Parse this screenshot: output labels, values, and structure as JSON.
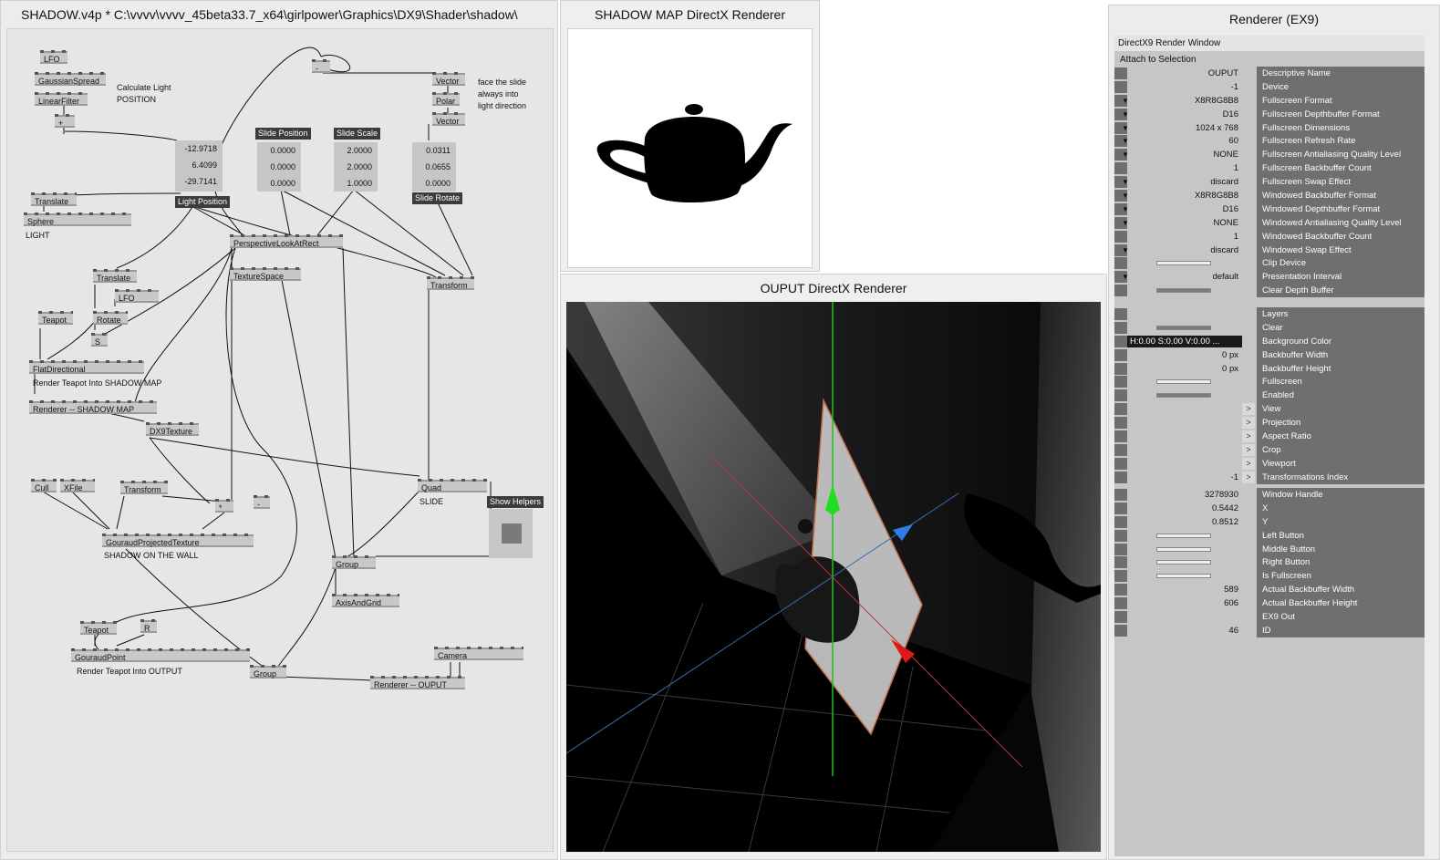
{
  "patch": {
    "title": "SHADOW.v4p *  C:\\vvvv\\vvvv_45beta33.7_x64\\girlpower\\Graphics\\DX9\\Shader\\shadow\\",
    "nodes": {
      "lfo1": "LFO",
      "gaussian": "GaussianSpread",
      "linearfilter": "LinearFilter",
      "plus": "+",
      "minus_top": "-",
      "vector1": "Vector",
      "polar": "Polar",
      "vector2": "Vector",
      "translate1": "Translate",
      "sphere": "Sphere",
      "perspective": "PerspectiveLookAtRect",
      "texturespace": "TextureSpace",
      "transform1": "Transform",
      "translate2": "Translate",
      "lfo2": "LFO",
      "teapot1": "Teapot",
      "rotate": "Rotate",
      "s": "S",
      "flatdirectional": "FlatDirectional",
      "renderer_shadow": "Renderer -- SHADOW MAP",
      "dx9texture": "DX9Texture",
      "cull": "Cull",
      "xfile": "XFile",
      "transform2": "Transform",
      "star": "*",
      "minus2": "-",
      "gouraudprojected": "GouraudProjectedTexture",
      "quad": "Quad",
      "group1": "Group",
      "axisandgrid": "AxisAndGrid",
      "teapot2": "Teapot",
      "r": "R",
      "gouraudpoint": "GouraudPoint",
      "group2": "Group",
      "camera": "Camera",
      "renderer_output": "Renderer -- OUPUT"
    },
    "comments": {
      "calc_light": "Calculate Light\nPOSITION",
      "face_slide": "face the slide\nalways into\nlight direction",
      "light": "LIGHT",
      "render_shadow": "Render Teapot Into SHADOW MAP",
      "shadow_wall": "SHADOW ON THE WALL",
      "slide": "SLIDE",
      "render_output": "Render Teapot Into OUTPUT"
    },
    "labels": {
      "light_position": "Light Position",
      "slide_position": "Slide Position",
      "slide_scale": "Slide Scale",
      "slide_rotate": "Slide Rotate",
      "show_helpers": "Show Helpers"
    },
    "values": {
      "light_position": [
        "-12.9718",
        "6.4099",
        "-29.7141"
      ],
      "slide_position": [
        "0.0000",
        "0.0000",
        "0.0000"
      ],
      "slide_scale": [
        "2.0000",
        "2.0000",
        "1.0000"
      ],
      "slide_rotate": [
        "0.0311",
        "0.0655",
        "0.0000"
      ]
    }
  },
  "shadow_window": {
    "title": "SHADOW MAP   DirectX Renderer"
  },
  "output_window": {
    "title": "OUPUT   DirectX Renderer"
  },
  "inspector": {
    "title": "Renderer (EX9)",
    "header": "DirectX9 Render Window",
    "attach": "Attach to Selection",
    "rows_top": [
      {
        "value": "OUPUT",
        "name": "Descriptive Name",
        "arrow": false
      },
      {
        "value": "-1",
        "name": "Device",
        "arrow": false
      },
      {
        "value": "X8R8G8B8",
        "name": "Fullscreen Format",
        "arrow": true
      },
      {
        "value": "D16",
        "name": "Fullscreen Depthbuffer Format",
        "arrow": true
      },
      {
        "value": "1024 x 768",
        "name": "Fullscreen Dimensions",
        "arrow": true
      },
      {
        "value": "60",
        "name": "Fullscreen Refresh Rate",
        "arrow": true
      },
      {
        "value": "NONE",
        "name": "Fullscreen Antialiasing Quality Level",
        "arrow": true
      },
      {
        "value": "1",
        "name": "Fullscreen Backbuffer Count",
        "arrow": false
      },
      {
        "value": "discard",
        "name": "Fullscreen Swap Effect",
        "arrow": true
      },
      {
        "value": "X8R8G8B8",
        "name": "Windowed Backbuffer Format",
        "arrow": true
      },
      {
        "value": "D16",
        "name": "Windowed Depthbuffer Format",
        "arrow": true
      },
      {
        "value": "NONE",
        "name": "Windowed Antialiasing Quality Level",
        "arrow": true
      },
      {
        "value": "1",
        "name": "Windowed Backbuffer Count",
        "arrow": false
      },
      {
        "value": "discard",
        "name": "Windowed Swap Effect",
        "arrow": true
      },
      {
        "value": "",
        "name": "Clip Device",
        "bar": "empty"
      },
      {
        "value": "default",
        "name": "Presentation Interval",
        "arrow": true
      },
      {
        "value": "",
        "name": "Clear Depth Buffer",
        "bar": "filled"
      }
    ],
    "rows_mid": [
      {
        "value": "",
        "name": "Layers"
      },
      {
        "value": "",
        "name": "Clear",
        "bar": "filled"
      },
      {
        "value": "H:0.00  S:0.00  V:0.00  ...",
        "name": "Background Color",
        "dark": true
      },
      {
        "value": "0 px",
        "name": "Backbuffer Width"
      },
      {
        "value": "0 px",
        "name": "Backbuffer Height"
      },
      {
        "value": "",
        "name": "Fullscreen",
        "bar": "empty"
      },
      {
        "value": "",
        "name": "Enabled",
        "bar": "filled"
      },
      {
        "value": "",
        "name": "View",
        "gt": true
      },
      {
        "value": "",
        "name": "Projection",
        "gt": true
      },
      {
        "value": "",
        "name": "Aspect Ratio",
        "gt": true
      },
      {
        "value": "",
        "name": "Crop",
        "gt": true
      },
      {
        "value": "",
        "name": "Viewport",
        "gt": true
      },
      {
        "value": "-1",
        "name": "Transformations Index",
        "gt": true
      }
    ],
    "rows_bottom": [
      {
        "value": "3278930",
        "name": "Window Handle"
      },
      {
        "value": "0.5442",
        "name": "X"
      },
      {
        "value": "0.8512",
        "name": "Y"
      },
      {
        "value": "",
        "name": "Left Button",
        "bar": "empty"
      },
      {
        "value": "",
        "name": "Middle Button",
        "bar": "empty"
      },
      {
        "value": "",
        "name": "Right Button",
        "bar": "empty"
      },
      {
        "value": "",
        "name": "Is Fullscreen",
        "bar": "empty"
      },
      {
        "value": "589",
        "name": "Actual Backbuffer Width"
      },
      {
        "value": "606",
        "name": "Actual Backbuffer Height"
      },
      {
        "value": "",
        "name": "EX9 Out"
      },
      {
        "value": "46",
        "name": "ID"
      }
    ]
  }
}
